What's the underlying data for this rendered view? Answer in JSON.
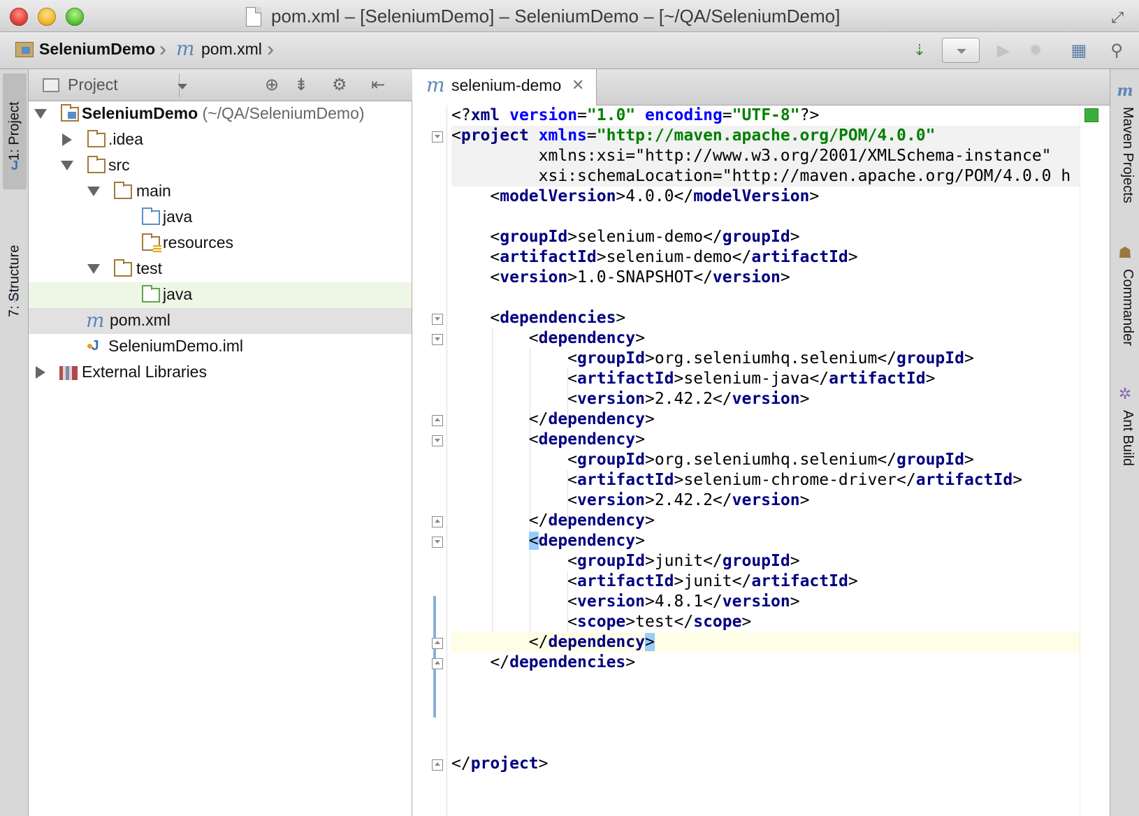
{
  "window": {
    "title": "pom.xml – [SeleniumDemo] – SeleniumDemo – [~/QA/SeleniumDemo]"
  },
  "navbar": {
    "project": "SeleniumDemo",
    "file": "pom.xml",
    "icons": [
      "make-project-icon",
      "run-config-dropdown",
      "run-icon",
      "debug-icon",
      "project-structure-icon",
      "search-icon"
    ]
  },
  "left_strip": {
    "tabs": [
      {
        "label": "1: Project",
        "active": true
      },
      {
        "label": "7: Structure",
        "active": false
      }
    ]
  },
  "right_strip": {
    "tabs": [
      "Maven Projects",
      "Commander",
      "Ant Build"
    ]
  },
  "project_panel": {
    "view_label": "Project",
    "tree": [
      {
        "label": "SeleniumDemo",
        "hint": "(~/QA/SeleniumDemo)",
        "level": 0,
        "expanded": true,
        "icon": "project-folder-icon"
      },
      {
        "label": ".idea",
        "level": 1,
        "expanded": false,
        "icon": "folder-icon"
      },
      {
        "label": "src",
        "level": 1,
        "expanded": true,
        "icon": "folder-icon"
      },
      {
        "label": "main",
        "level": 2,
        "expanded": true,
        "icon": "folder-icon"
      },
      {
        "label": "java",
        "level": 3,
        "icon": "source-folder-icon"
      },
      {
        "label": "resources",
        "level": 3,
        "icon": "resources-folder-icon"
      },
      {
        "label": "test",
        "level": 2,
        "expanded": true,
        "icon": "folder-icon"
      },
      {
        "label": "java",
        "level": 3,
        "icon": "test-folder-icon"
      },
      {
        "label": "pom.xml",
        "level": 1,
        "icon": "maven-icon",
        "selected": true
      },
      {
        "label": "SeleniumDemo.iml",
        "level": 1,
        "icon": "iml-icon"
      },
      {
        "label": "External Libraries",
        "level": 0,
        "expanded": false,
        "icon": "library-icon"
      }
    ]
  },
  "editor": {
    "tab_label": "selenium-demo",
    "lines": [
      "<?xml version=\"1.0\" encoding=\"UTF-8\"?>",
      "<project xmlns=\"http://maven.apache.org/POM/4.0.0\"",
      "         xmlns:xsi=\"http://www.w3.org/2001/XMLSchema-instance\"",
      "         xsi:schemaLocation=\"http://maven.apache.org/POM/4.0.0 h",
      "    <modelVersion>4.0.0</modelVersion>",
      "",
      "    <groupId>selenium-demo</groupId>",
      "    <artifactId>selenium-demo</artifactId>",
      "    <version>1.0-SNAPSHOT</version>",
      "",
      "    <dependencies>",
      "        <dependency>",
      "            <groupId>org.seleniumhq.selenium</groupId>",
      "            <artifactId>selenium-java</artifactId>",
      "            <version>2.42.2</version>",
      "        </dependency>",
      "        <dependency>",
      "            <groupId>org.seleniumhq.selenium</groupId>",
      "            <artifactId>selenium-chrome-driver</artifactId>",
      "            <version>2.42.2</version>",
      "        </dependency>",
      "        <dependency>",
      "            <groupId>junit</groupId>",
      "            <artifactId>junit</artifactId>",
      "            <version>4.8.1</version>",
      "            <scope>test</scope>",
      "        </dependency>",
      "    </dependencies>",
      "",
      "",
      "",
      "",
      "</project>"
    ]
  },
  "colors": {
    "tag": "#000080",
    "attribute": "#0000ff",
    "namespace_attribute": "#660e7a",
    "value": "#008000",
    "current_line": "#fefde5",
    "selection": "#e1e1e1"
  }
}
